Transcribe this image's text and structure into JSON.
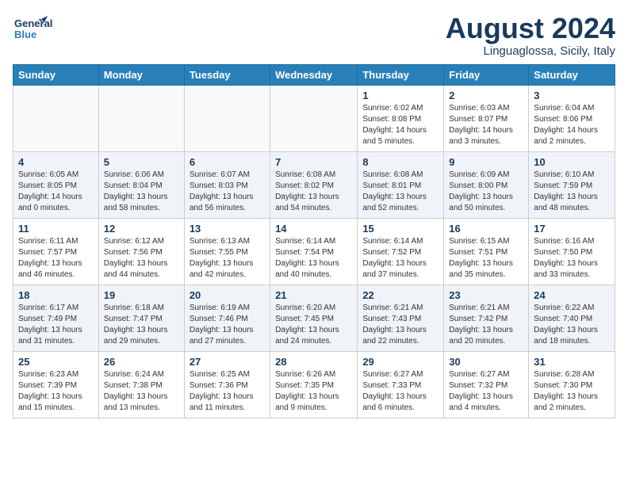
{
  "header": {
    "logo_line1": "General",
    "logo_line2": "Blue",
    "title": "August 2024",
    "subtitle": "Linguaglossa, Sicily, Italy"
  },
  "calendar": {
    "days_of_week": [
      "Sunday",
      "Monday",
      "Tuesday",
      "Wednesday",
      "Thursday",
      "Friday",
      "Saturday"
    ],
    "weeks": [
      [
        {
          "day": "",
          "detail": ""
        },
        {
          "day": "",
          "detail": ""
        },
        {
          "day": "",
          "detail": ""
        },
        {
          "day": "",
          "detail": ""
        },
        {
          "day": "1",
          "detail": "Sunrise: 6:02 AM\nSunset: 8:08 PM\nDaylight: 14 hours\nand 5 minutes."
        },
        {
          "day": "2",
          "detail": "Sunrise: 6:03 AM\nSunset: 8:07 PM\nDaylight: 14 hours\nand 3 minutes."
        },
        {
          "day": "3",
          "detail": "Sunrise: 6:04 AM\nSunset: 8:06 PM\nDaylight: 14 hours\nand 2 minutes."
        }
      ],
      [
        {
          "day": "4",
          "detail": "Sunrise: 6:05 AM\nSunset: 8:05 PM\nDaylight: 14 hours\nand 0 minutes."
        },
        {
          "day": "5",
          "detail": "Sunrise: 6:06 AM\nSunset: 8:04 PM\nDaylight: 13 hours\nand 58 minutes."
        },
        {
          "day": "6",
          "detail": "Sunrise: 6:07 AM\nSunset: 8:03 PM\nDaylight: 13 hours\nand 56 minutes."
        },
        {
          "day": "7",
          "detail": "Sunrise: 6:08 AM\nSunset: 8:02 PM\nDaylight: 13 hours\nand 54 minutes."
        },
        {
          "day": "8",
          "detail": "Sunrise: 6:08 AM\nSunset: 8:01 PM\nDaylight: 13 hours\nand 52 minutes."
        },
        {
          "day": "9",
          "detail": "Sunrise: 6:09 AM\nSunset: 8:00 PM\nDaylight: 13 hours\nand 50 minutes."
        },
        {
          "day": "10",
          "detail": "Sunrise: 6:10 AM\nSunset: 7:59 PM\nDaylight: 13 hours\nand 48 minutes."
        }
      ],
      [
        {
          "day": "11",
          "detail": "Sunrise: 6:11 AM\nSunset: 7:57 PM\nDaylight: 13 hours\nand 46 minutes."
        },
        {
          "day": "12",
          "detail": "Sunrise: 6:12 AM\nSunset: 7:56 PM\nDaylight: 13 hours\nand 44 minutes."
        },
        {
          "day": "13",
          "detail": "Sunrise: 6:13 AM\nSunset: 7:55 PM\nDaylight: 13 hours\nand 42 minutes."
        },
        {
          "day": "14",
          "detail": "Sunrise: 6:14 AM\nSunset: 7:54 PM\nDaylight: 13 hours\nand 40 minutes."
        },
        {
          "day": "15",
          "detail": "Sunrise: 6:14 AM\nSunset: 7:52 PM\nDaylight: 13 hours\nand 37 minutes."
        },
        {
          "day": "16",
          "detail": "Sunrise: 6:15 AM\nSunset: 7:51 PM\nDaylight: 13 hours\nand 35 minutes."
        },
        {
          "day": "17",
          "detail": "Sunrise: 6:16 AM\nSunset: 7:50 PM\nDaylight: 13 hours\nand 33 minutes."
        }
      ],
      [
        {
          "day": "18",
          "detail": "Sunrise: 6:17 AM\nSunset: 7:49 PM\nDaylight: 13 hours\nand 31 minutes."
        },
        {
          "day": "19",
          "detail": "Sunrise: 6:18 AM\nSunset: 7:47 PM\nDaylight: 13 hours\nand 29 minutes."
        },
        {
          "day": "20",
          "detail": "Sunrise: 6:19 AM\nSunset: 7:46 PM\nDaylight: 13 hours\nand 27 minutes."
        },
        {
          "day": "21",
          "detail": "Sunrise: 6:20 AM\nSunset: 7:45 PM\nDaylight: 13 hours\nand 24 minutes."
        },
        {
          "day": "22",
          "detail": "Sunrise: 6:21 AM\nSunset: 7:43 PM\nDaylight: 13 hours\nand 22 minutes."
        },
        {
          "day": "23",
          "detail": "Sunrise: 6:21 AM\nSunset: 7:42 PM\nDaylight: 13 hours\nand 20 minutes."
        },
        {
          "day": "24",
          "detail": "Sunrise: 6:22 AM\nSunset: 7:40 PM\nDaylight: 13 hours\nand 18 minutes."
        }
      ],
      [
        {
          "day": "25",
          "detail": "Sunrise: 6:23 AM\nSunset: 7:39 PM\nDaylight: 13 hours\nand 15 minutes."
        },
        {
          "day": "26",
          "detail": "Sunrise: 6:24 AM\nSunset: 7:38 PM\nDaylight: 13 hours\nand 13 minutes."
        },
        {
          "day": "27",
          "detail": "Sunrise: 6:25 AM\nSunset: 7:36 PM\nDaylight: 13 hours\nand 11 minutes."
        },
        {
          "day": "28",
          "detail": "Sunrise: 6:26 AM\nSunset: 7:35 PM\nDaylight: 13 hours\nand 9 minutes."
        },
        {
          "day": "29",
          "detail": "Sunrise: 6:27 AM\nSunset: 7:33 PM\nDaylight: 13 hours\nand 6 minutes."
        },
        {
          "day": "30",
          "detail": "Sunrise: 6:27 AM\nSunset: 7:32 PM\nDaylight: 13 hours\nand 4 minutes."
        },
        {
          "day": "31",
          "detail": "Sunrise: 6:28 AM\nSunset: 7:30 PM\nDaylight: 13 hours\nand 2 minutes."
        }
      ]
    ]
  }
}
